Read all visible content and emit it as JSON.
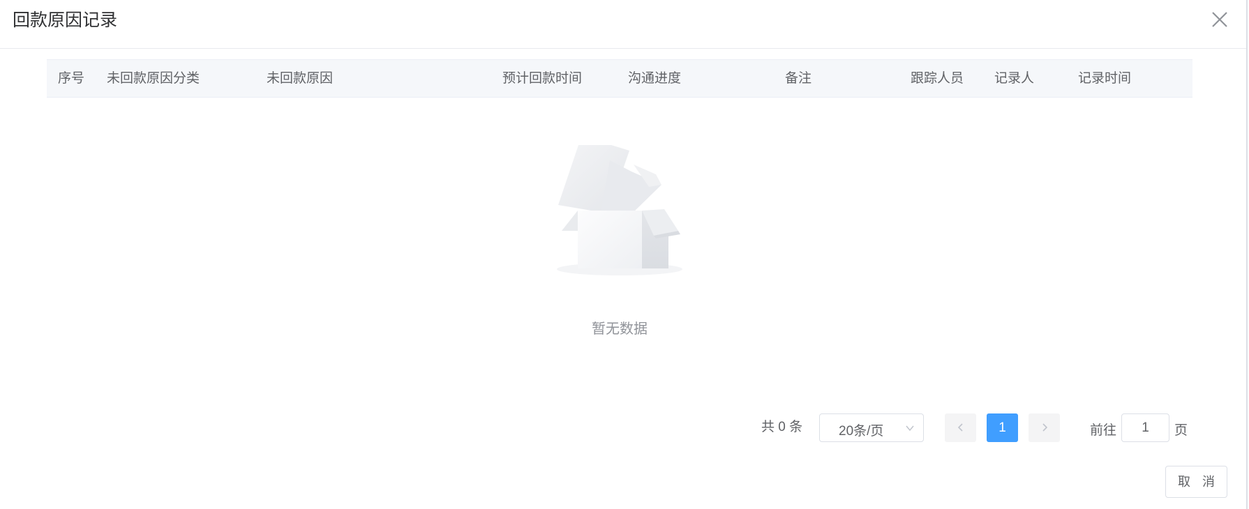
{
  "dialog": {
    "title": "回款原因记录",
    "close_icon": "close-icon"
  },
  "table": {
    "columns": [
      "序号",
      "未回款原因分类",
      "未回款原因",
      "预计回款时间",
      "沟通进度",
      "备注",
      "跟踪人员",
      "记录人",
      "记录时间"
    ],
    "rows": [],
    "empty_text": "暂无数据",
    "empty_icon": "empty-box-icon"
  },
  "pagination": {
    "total_label": "共 0 条",
    "page_size": "20条/页",
    "current_page": "1",
    "goto_label": "前往",
    "goto_value": "1",
    "page_suffix": "页",
    "prev_icon": "chevron-left-icon",
    "next_icon": "chevron-right-icon"
  },
  "footer": {
    "cancel_label": "取 消"
  },
  "colors": {
    "accent": "#409eff",
    "header_bg": "#f5f7fa",
    "text": "#303133",
    "muted_text": "#909399"
  }
}
